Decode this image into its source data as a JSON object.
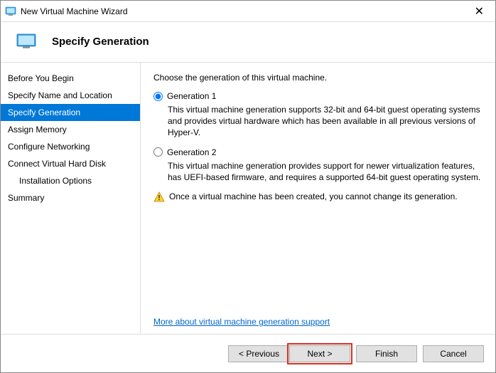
{
  "window": {
    "title": "New Virtual Machine Wizard"
  },
  "header": {
    "title": "Specify Generation"
  },
  "sidebar": {
    "items": [
      {
        "label": "Before You Begin"
      },
      {
        "label": "Specify Name and Location"
      },
      {
        "label": "Specify Generation"
      },
      {
        "label": "Assign Memory"
      },
      {
        "label": "Configure Networking"
      },
      {
        "label": "Connect Virtual Hard Disk"
      },
      {
        "label": "Installation Options"
      },
      {
        "label": "Summary"
      }
    ]
  },
  "main": {
    "instruction": "Choose the generation of this virtual machine.",
    "option1": {
      "label": "Generation 1",
      "desc": "This virtual machine generation supports 32-bit and 64-bit guest operating systems and provides virtual hardware which has been available in all previous versions of Hyper-V."
    },
    "option2": {
      "label": "Generation 2",
      "desc": "This virtual machine generation provides support for newer virtualization features, has UEFI-based firmware, and requires a supported 64-bit guest operating system."
    },
    "warning": "Once a virtual machine has been created, you cannot change its generation.",
    "help_link": "More about virtual machine generation support"
  },
  "footer": {
    "previous": "< Previous",
    "next": "Next >",
    "finish": "Finish",
    "cancel": "Cancel"
  }
}
